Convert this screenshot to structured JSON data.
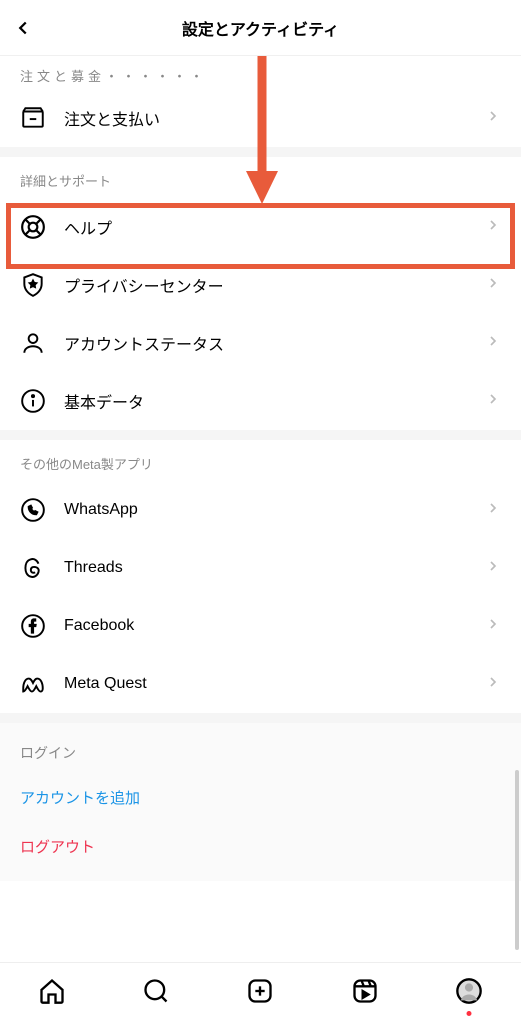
{
  "header": {
    "title": "設定とアクティビティ"
  },
  "truncated_prev_header": "・・・・・・・・・・・・",
  "orders": {
    "label": "注文と支払い"
  },
  "section_more": {
    "header": "詳細とサポート",
    "items": [
      {
        "label": "ヘルプ"
      },
      {
        "label": "プライバシーセンター"
      },
      {
        "label": "アカウントステータス"
      },
      {
        "label": "基本データ"
      }
    ]
  },
  "section_meta": {
    "header": "その他のMeta製アプリ",
    "items": [
      {
        "label": "WhatsApp"
      },
      {
        "label": "Threads"
      },
      {
        "label": "Facebook"
      },
      {
        "label": "Meta Quest"
      }
    ]
  },
  "login": {
    "header": "ログイン",
    "add_account": "アカウントを追加",
    "logout": "ログアウト"
  }
}
